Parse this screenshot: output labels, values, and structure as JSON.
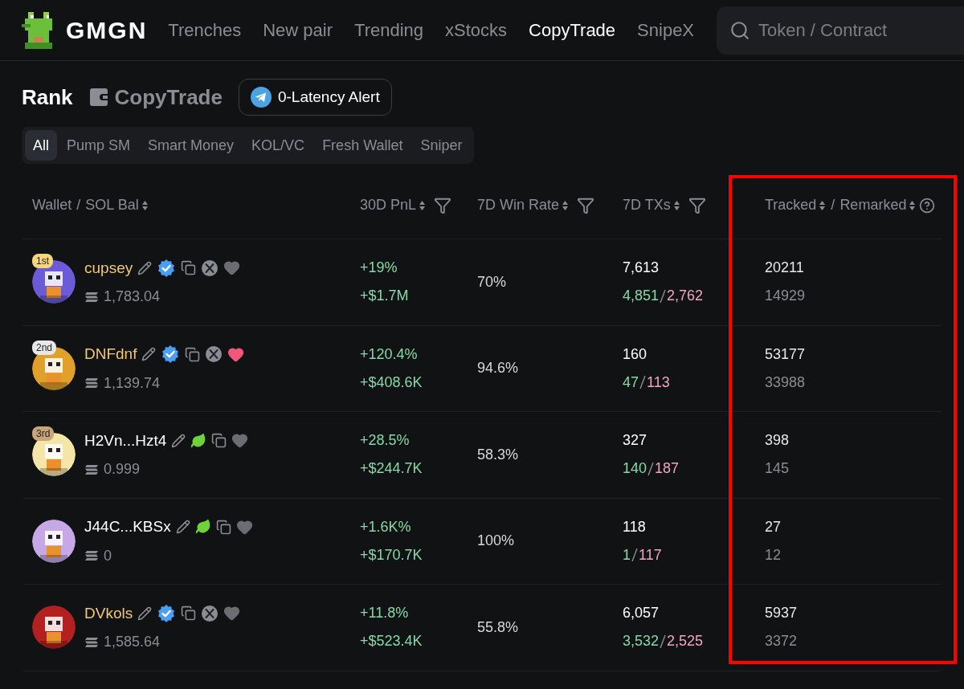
{
  "header": {
    "logo": "GMGN",
    "nav": [
      {
        "label": "Trenches",
        "selected": false
      },
      {
        "label": "New pair",
        "selected": false
      },
      {
        "label": "Trending",
        "selected": false
      },
      {
        "label": "xStocks",
        "selected": false
      },
      {
        "label": "CopyTrade",
        "selected": true
      },
      {
        "label": "SnipeX",
        "selected": false
      }
    ],
    "search": {
      "placeholder": "Token / Contract"
    }
  },
  "title": {
    "rank": "Rank",
    "section": "CopyTrade",
    "alert_button": "0-Latency Alert"
  },
  "tabs": [
    {
      "label": "All",
      "selected": true
    },
    {
      "label": "Pump SM",
      "selected": false
    },
    {
      "label": "Smart Money",
      "selected": false
    },
    {
      "label": "KOL/VC",
      "selected": false
    },
    {
      "label": "Fresh Wallet",
      "selected": false
    },
    {
      "label": "Sniper",
      "selected": false
    }
  ],
  "table": {
    "columns": [
      {
        "label": "Wallet",
        "separator": "/",
        "sub_label": "SOL Bal",
        "filter": false
      },
      {
        "label": "30D PnL",
        "filter": true
      },
      {
        "label": "7D Win Rate",
        "filter": true
      },
      {
        "label": "7D TXs",
        "filter": true
      },
      {
        "label": "Tracked",
        "separator": "/",
        "sub_label": "Remarked",
        "filter": false,
        "help": true
      }
    ],
    "rows": [
      {
        "rank": {
          "label": "1st",
          "color": "#f5d77a"
        },
        "kind": "kol",
        "name": "cupsey",
        "badge": {
          "kind": "verified"
        },
        "twitter": true,
        "favorited": false,
        "balance": "1,783.04",
        "pnl_pct": "+19%",
        "pnl_usd": "+$1.7M",
        "win_rate": "70%",
        "txs": "7,613",
        "buys": "4,851",
        "sells": "2,762",
        "tracked": "20211",
        "remarked": "14929"
      },
      {
        "rank": {
          "label": "2nd",
          "color": "#e8e8e8"
        },
        "kind": "kol",
        "name": "DNFdnf",
        "badge": {
          "kind": "verified"
        },
        "twitter": true,
        "favorited": true,
        "balance": "1,139.74",
        "pnl_pct": "+120.4%",
        "pnl_usd": "+$408.6K",
        "win_rate": "94.6%",
        "txs": "160",
        "buys": "47",
        "sells": "113",
        "tracked": "53177",
        "remarked": "33988"
      },
      {
        "rank": {
          "label": "3rd",
          "color": "#c9a67a"
        },
        "kind": "wallet",
        "name": "H2Vn...Hzt4",
        "badge": {
          "kind": "leaf"
        },
        "twitter": false,
        "favorited": false,
        "balance": "0.999",
        "pnl_pct": "+28.5%",
        "pnl_usd": "+$244.7K",
        "win_rate": "58.3%",
        "txs": "327",
        "buys": "140",
        "sells": "187",
        "tracked": "398",
        "remarked": "145"
      },
      {
        "kind": "wallet",
        "name": "J44C...KBSx",
        "badge": {
          "kind": "leaf"
        },
        "twitter": false,
        "favorited": false,
        "balance": "0",
        "pnl_pct": "+1.6K%",
        "pnl_usd": "+$170.7K",
        "win_rate": "100%",
        "txs": "118",
        "buys": "1",
        "sells": "117",
        "tracked": "27",
        "remarked": "12"
      },
      {
        "kind": "kol",
        "name": "DVkols",
        "badge": {
          "kind": "verified"
        },
        "twitter": true,
        "favorited": false,
        "balance": "1,585.64",
        "pnl_pct": "+11.8%",
        "pnl_usd": "+$523.4K",
        "win_rate": "55.8%",
        "txs": "6,057",
        "buys": "3,532",
        "sells": "2,525",
        "tracked": "5937",
        "remarked": "3372"
      }
    ]
  },
  "highlight": {
    "color": "#ff0000"
  }
}
